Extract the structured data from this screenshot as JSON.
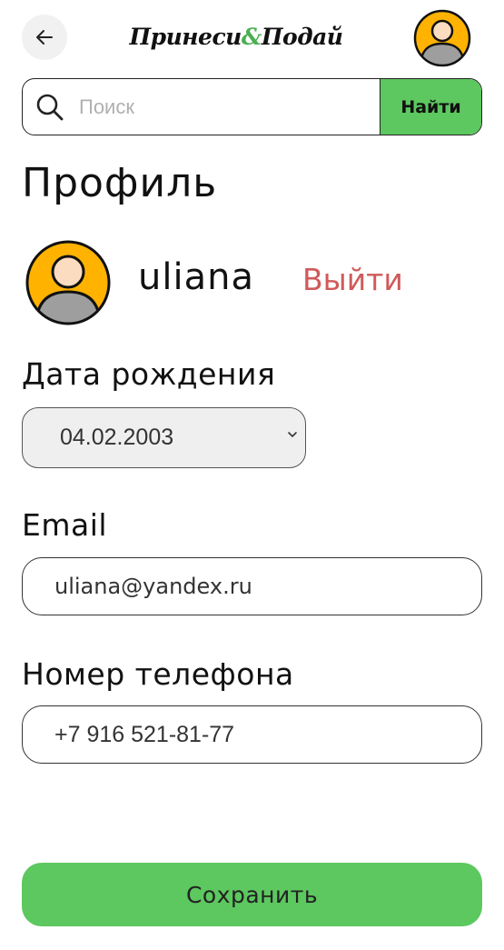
{
  "header": {
    "logo_part1": "Принеси",
    "logo_amp": "&",
    "logo_part2": "Подай",
    "back_icon": "arrow-left-icon",
    "avatar_icon": "user-avatar-icon"
  },
  "search": {
    "placeholder": "Поиск",
    "value": "",
    "button_label": "Найти"
  },
  "profile": {
    "title": "Профиль",
    "username": "uliana",
    "logout_label": "Выйти"
  },
  "form": {
    "dob_label": "Дата рождения",
    "dob_value": "04.02.2003",
    "email_label": "Email",
    "email_value": "uliana@yandex.ru",
    "phone_label": "Номер телефона",
    "phone_value": "+7 916 521-81-77",
    "save_label": "Сохранить"
  },
  "colors": {
    "accent_green": "#5cc85f",
    "logout_red": "#d05a5a",
    "avatar_orange": "#ffb300"
  }
}
